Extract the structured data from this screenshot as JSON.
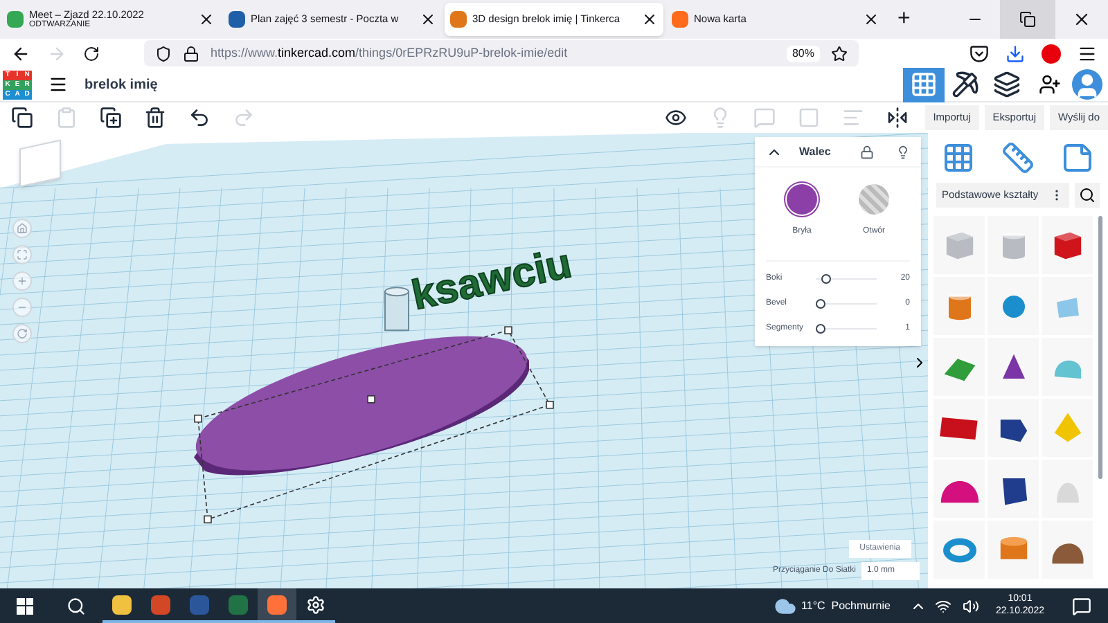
{
  "browser": {
    "tabs": [
      {
        "title": "Meet – Zjazd 22.10.2022",
        "subtitle": "ODTWARZANIE",
        "selected": false
      },
      {
        "title": "Plan zajęć 3 semestr - Poczta w",
        "selected": false
      },
      {
        "title": "3D design brelok imię | Tinkerca",
        "selected": true
      },
      {
        "title": "Nowa karta",
        "selected": false
      }
    ],
    "new_tab": "+",
    "url_prefix": "https://www.",
    "url_domain": "tinkercad.com",
    "url_path": "/things/0rEPRzRU9uP-brelok-imie/edit",
    "zoom": "80%"
  },
  "app": {
    "logo_letters": [
      "T",
      "I",
      "N",
      "K",
      "E",
      "R",
      "C",
      "A",
      "D"
    ],
    "design_name": "brelok imię",
    "views": [
      {
        "kind": "grid",
        "selected": true
      },
      {
        "kind": "pickaxe",
        "selected": false
      },
      {
        "kind": "bricks",
        "selected": false
      }
    ],
    "tools_left": [
      {
        "kind": "copy",
        "disabled": false
      },
      {
        "kind": "paste",
        "disabled": true
      },
      {
        "kind": "duplicate",
        "disabled": false
      },
      {
        "kind": "delete",
        "disabled": false
      },
      {
        "kind": "undo",
        "disabled": false
      },
      {
        "kind": "redo",
        "disabled": true
      }
    ],
    "tools_right": [
      {
        "kind": "notes",
        "disabled": false
      },
      {
        "kind": "bulb",
        "disabled": true
      },
      {
        "kind": "group",
        "disabled": true
      },
      {
        "kind": "ungroup",
        "disabled": true
      },
      {
        "kind": "align",
        "disabled": true
      },
      {
        "kind": "mirror",
        "disabled": false
      }
    ],
    "actions": [
      "Importuj",
      "Eksportuj",
      "Wyślij do"
    ]
  },
  "scene": {
    "text_object": "ksawciu"
  },
  "inspector": {
    "title": "Walec",
    "modes": [
      {
        "label": "Bryła",
        "kind": "solid",
        "selected": true
      },
      {
        "label": "Otwór",
        "kind": "hole",
        "selected": false
      }
    ],
    "params": [
      {
        "label": "Boki",
        "level": 0.1,
        "value": "20"
      },
      {
        "label": "Bevel",
        "level": 0,
        "value": "0"
      },
      {
        "label": "Segmenty",
        "level": 0,
        "value": "1"
      }
    ]
  },
  "settings": {
    "button": "Ustawienia",
    "snap_label": "Przyciąganie Do Siatki",
    "snap_value": "1.0 mm"
  },
  "library": {
    "category": "Podstawowe kształty",
    "shapes": [
      {
        "kind": "box",
        "color": "#b8bcc2"
      },
      {
        "kind": "cylinder",
        "color": "#b8bcc2"
      },
      {
        "kind": "box",
        "color": "#d0141c"
      },
      {
        "kind": "cylinder",
        "color": "#e0761a"
      },
      {
        "kind": "sphere",
        "color": "#1b8fce"
      },
      {
        "kind": "scribble",
        "color": "#8cc6e8"
      },
      {
        "kind": "roof",
        "color": "#2f9e3a"
      },
      {
        "kind": "cone",
        "color": "#7b35a6"
      },
      {
        "kind": "round-roof",
        "color": "#63c3d1"
      },
      {
        "kind": "text",
        "color": "#c8101c"
      },
      {
        "kind": "polygon",
        "color": "#1f3d8c"
      },
      {
        "kind": "pyramid",
        "color": "#f0c400"
      },
      {
        "kind": "half-sphere",
        "color": "#d4107f"
      },
      {
        "kind": "prism",
        "color": "#1f3d8c"
      },
      {
        "kind": "paraboloid",
        "color": "#d9d9d9"
      },
      {
        "kind": "torus",
        "color": "#1b8fce"
      },
      {
        "kind": "tube",
        "color": "#e0761a"
      },
      {
        "kind": "organic",
        "color": "#8a5a3a"
      }
    ]
  },
  "taskbar": {
    "apps": [
      {
        "kind": "explorer",
        "selected": false
      },
      {
        "kind": "powerpoint",
        "selected": false
      },
      {
        "kind": "word",
        "selected": false
      },
      {
        "kind": "excel",
        "selected": false
      },
      {
        "kind": "firefox",
        "selected": true
      },
      {
        "kind": "settings",
        "selected": false
      }
    ],
    "weather": "11°C  Pochmurnie",
    "time": "10:01",
    "date": "22.10.2022"
  }
}
